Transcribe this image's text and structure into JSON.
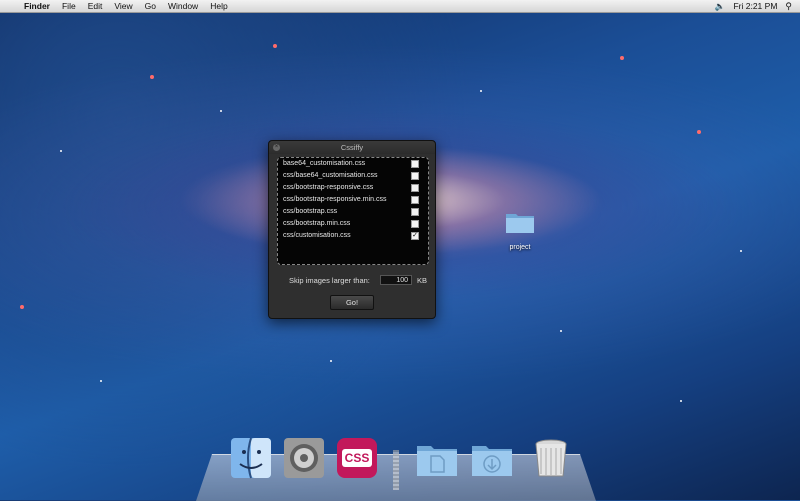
{
  "menubar": {
    "items": [
      "Finder",
      "File",
      "Edit",
      "View",
      "Go",
      "Window",
      "Help"
    ],
    "clock": "Fri 2:21 PM"
  },
  "window": {
    "title": "Cssiffy",
    "files": [
      {
        "name": "base64_customisation.css",
        "checked": false
      },
      {
        "name": "css/base64_customisation.css",
        "checked": false
      },
      {
        "name": "css/bootstrap-responsive.css",
        "checked": false
      },
      {
        "name": "css/bootstrap-responsive.min.css",
        "checked": false
      },
      {
        "name": "css/bootstrap.css",
        "checked": false
      },
      {
        "name": "css/bootstrap.min.css",
        "checked": false
      },
      {
        "name": "css/customisation.css",
        "checked": true
      }
    ],
    "skip_label": "Skip images larger than:",
    "skip_value": "100",
    "skip_unit": "KB",
    "go_label": "Go!"
  },
  "desktop": {
    "folder_label": "project"
  },
  "dock": {
    "css_app_label": "CSS"
  },
  "colors": {
    "folder_blue": "#8fc0e6",
    "css_app": "#c2185b"
  }
}
